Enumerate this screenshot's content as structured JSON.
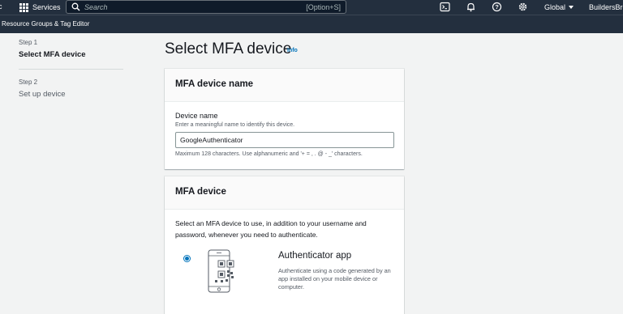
{
  "topnav": {
    "services_label": "Services",
    "search_placeholder": "Search",
    "search_shortcut": "[Option+S]",
    "region_label": "Global",
    "account_label": "BuildersBrew"
  },
  "subnav": {
    "resource_groups_label": "Resource Groups & Tag Editor"
  },
  "steps": [
    {
      "num": "Step 1",
      "title": "Select MFA device"
    },
    {
      "num": "Step 2",
      "title": "Set up device"
    }
  ],
  "page": {
    "title": "Select MFA device",
    "info_label": "Info"
  },
  "device_name_panel": {
    "heading": "MFA device name",
    "field_label": "Device name",
    "field_description": "Enter a meaningful name to identify this device.",
    "field_value": "GoogleAuthenticator",
    "constraint": "Maximum 128 characters. Use alphanumeric and '+ = , . @ - _' characters."
  },
  "mfa_device_panel": {
    "heading": "MFA device",
    "description": "Select an MFA device to use, in addition to your username and password, whenever you need to authenticate.",
    "options": [
      {
        "title": "Authenticator app",
        "description": "Authenticate using a code generated by an app installed on your mobile device or computer.",
        "selected": true,
        "icon": "authenticator-phone-icon"
      }
    ]
  },
  "colors": {
    "nav_bg": "#232f3e",
    "accent": "#0073bb",
    "page_bg": "#f2f3f3"
  }
}
